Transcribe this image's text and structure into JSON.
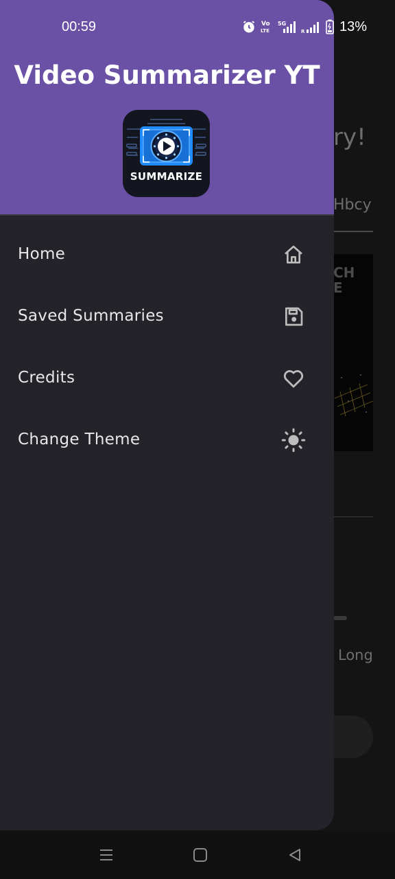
{
  "status_bar": {
    "time": "00:59",
    "battery": "13%",
    "icons": [
      "alarm-icon",
      "volte-icon",
      "5g-signal-icon",
      "signal-icon",
      "battery-icon"
    ]
  },
  "background_app": {
    "title_fragment": "ry!",
    "input_fragment": "Hbcy",
    "thumbnail_fragment": "CH\nE",
    "length_option": "Long"
  },
  "drawer": {
    "title": "Video Summarizer YT",
    "logo_text": "SUMMARIZE",
    "items": [
      {
        "label": "Home",
        "icon": "home-icon"
      },
      {
        "label": "Saved Summaries",
        "icon": "save-icon"
      },
      {
        "label": "Credits",
        "icon": "heart-icon"
      },
      {
        "label": "Change Theme",
        "icon": "sun-icon"
      }
    ]
  },
  "nav_bar": {
    "buttons": [
      "menu-icon",
      "home-square-icon",
      "back-icon"
    ]
  },
  "colors": {
    "header_purple": "#6a51a6",
    "drawer_bg": "#232329",
    "icon_gray": "#bdbdbd",
    "logo_blue": "#1f8bff"
  }
}
